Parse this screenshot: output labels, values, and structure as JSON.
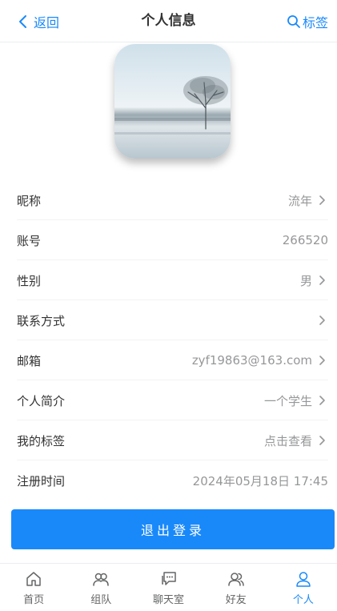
{
  "navbar": {
    "back_label": "返回",
    "title": "个人信息",
    "tags_label": "标签"
  },
  "avatar": {
    "icon": "tree-landscape-image"
  },
  "cells": [
    {
      "title": "昵称",
      "value": "流年",
      "arrow": true
    },
    {
      "title": "账号",
      "value": "266520",
      "arrow": false
    },
    {
      "title": "性别",
      "value": "男",
      "arrow": true
    },
    {
      "title": "联系方式",
      "value": "",
      "arrow": true
    },
    {
      "title": "邮箱",
      "value": "zyf19863@163.com",
      "arrow": true
    },
    {
      "title": "个人简介",
      "value": "一个学生",
      "arrow": true
    },
    {
      "title": "我的标签",
      "value": "点击查看",
      "arrow": true
    },
    {
      "title": "注册时间",
      "value": "2024年05月18日 17:45",
      "arrow": false
    }
  ],
  "logout_label": "退出登录",
  "tabbar": {
    "items": [
      {
        "label": "首页",
        "icon": "home-icon"
      },
      {
        "label": "组队",
        "icon": "team-icon"
      },
      {
        "label": "聊天室",
        "icon": "chat-icon"
      },
      {
        "label": "好友",
        "icon": "friends-icon"
      },
      {
        "label": "个人",
        "icon": "user-icon"
      }
    ],
    "active_index": 4
  },
  "colors": {
    "accent": "#1989fa",
    "text": "#323233",
    "muted": "#969799"
  }
}
